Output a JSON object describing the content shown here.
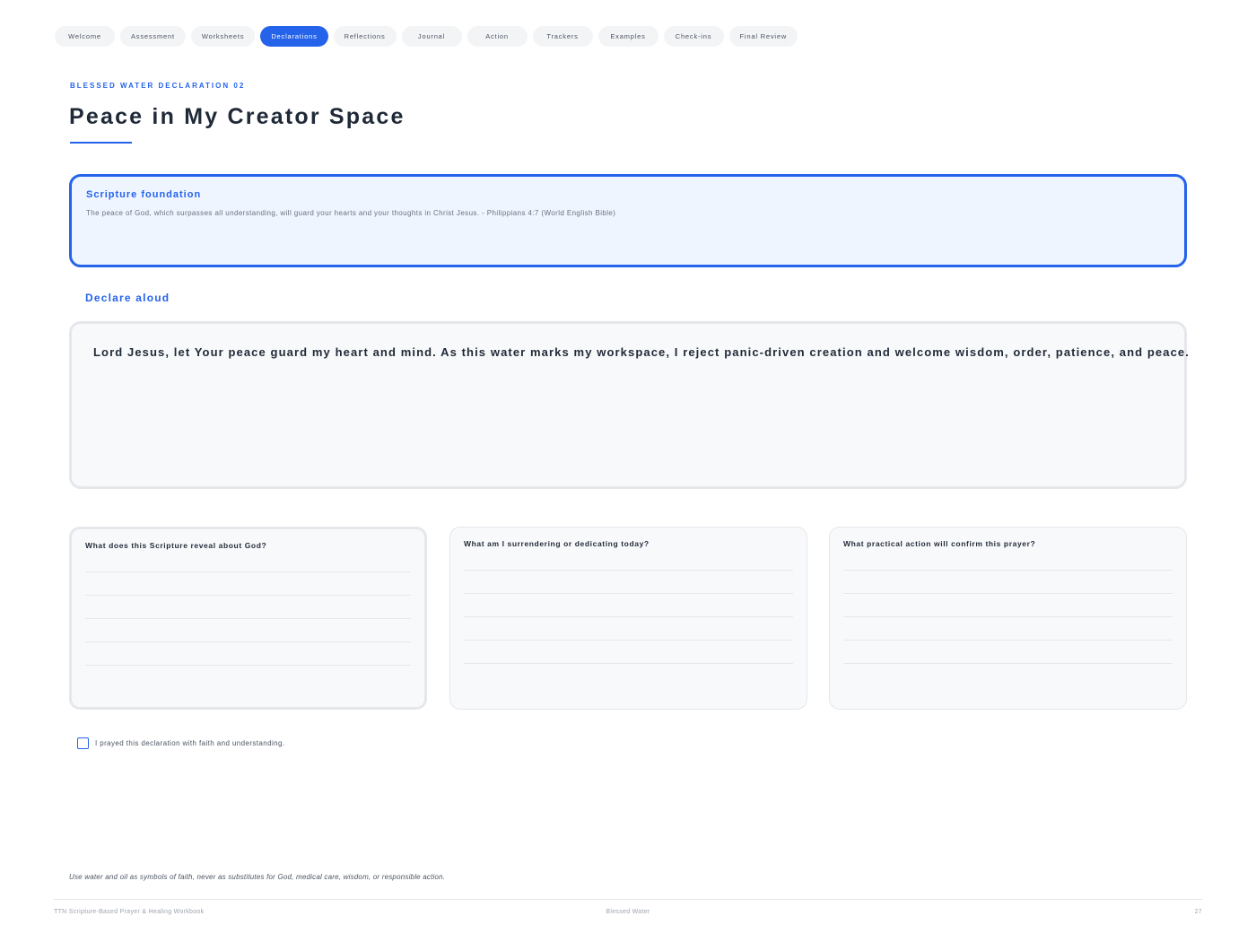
{
  "nav": {
    "tabs": [
      {
        "label": "Welcome"
      },
      {
        "label": "Assessment"
      },
      {
        "label": "Worksheets"
      },
      {
        "label": "Declarations",
        "active": true
      },
      {
        "label": "Reflections"
      },
      {
        "label": "Journal"
      },
      {
        "label": "Action"
      },
      {
        "label": "Trackers"
      },
      {
        "label": "Examples"
      },
      {
        "label": "Check-ins"
      },
      {
        "label": "Final Review"
      }
    ]
  },
  "header": {
    "eyebrow": "BLESSED WATER DECLARATION 02",
    "title": "Peace in My Creator Space"
  },
  "scripture": {
    "heading": "Scripture foundation",
    "text": "The peace of God, which surpasses all understanding, will guard your hearts and your thoughts in Christ Jesus. - Philippians 4:7 (World English Bible)"
  },
  "declaration": {
    "label": "Declare aloud",
    "text": "Lord Jesus, let Your peace guard my heart and mind. As this water marks my workspace, I reject panic-driven creation and welcome wisdom, order, patience, and peace."
  },
  "prompts": [
    {
      "question": "What does this Scripture reveal about God?"
    },
    {
      "question": "What am I surrendering or dedicating today?"
    },
    {
      "question": "What practical action will confirm this prayer?"
    }
  ],
  "confirmation": {
    "label": "I prayed this declaration with faith and understanding.",
    "checked": false
  },
  "disclaimer": "Use water and oil as symbols of faith, never as substitutes for God, medical care, wisdom, or responsible action.",
  "footer": {
    "left": "TTN Scripture-Based Prayer & Healing Workbook",
    "center": "Blessed Water",
    "page_number": "27"
  },
  "colors": {
    "accent": "#2563eb",
    "card_tint": "#eef5ff",
    "card_neutral": "#f8f9fb"
  }
}
